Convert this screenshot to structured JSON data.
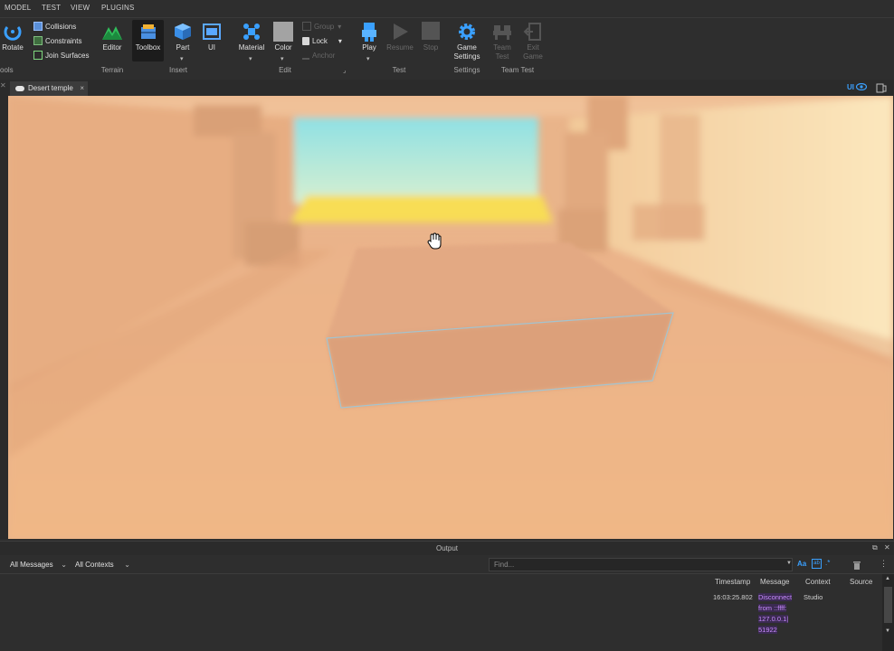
{
  "menu_tabs": [
    "MODEL",
    "TEST",
    "VIEW",
    "PLUGINS"
  ],
  "ribbon": {
    "rotate_label": "Rotate",
    "tools_group_label": "ools",
    "collisions_label": "Collisions",
    "constraints_label": "Constraints",
    "join_surfaces_label": "Join Surfaces",
    "editor_label": "Editor",
    "terrain_group_label": "Terrain",
    "toolbox_label": "Toolbox",
    "part_label": "Part",
    "ui_label": "UI",
    "insert_group_label": "Insert",
    "material_label": "Material",
    "color_label": "Color",
    "group_label": "Group",
    "lock_label": "Lock",
    "anchor_label": "Anchor",
    "edit_group_label": "Edit",
    "play_label": "Play",
    "resume_label": "Resume",
    "stop_label": "Stop",
    "test_group_label": "Test",
    "game_settings_label_1": "Game",
    "game_settings_label_2": "Settings",
    "settings_group_label": "Settings",
    "team_test_label_1": "Team",
    "team_test_label_2": "Test",
    "exit_game_label_1": "Exit",
    "exit_game_label_2": "Game",
    "team_test_group_label": "Team Test"
  },
  "doc_tab": {
    "title": "Desert temple",
    "close": "×"
  },
  "ui_toggle_label": "UI",
  "output": {
    "title": "Output",
    "filter_messages": "All Messages",
    "filter_contexts": "All Contexts",
    "find_placeholder": "Find...",
    "aa_label": "Aa",
    "columns": [
      "Timestamp",
      "Message",
      "Context",
      "Source"
    ],
    "rows": [
      {
        "timestamp": "16:03:25.802",
        "message_lines": [
          "Disconnect",
          "from ::ffff:",
          "127.0.0.1|",
          "51922"
        ],
        "context": "Studio",
        "source": ""
      }
    ]
  },
  "colors": {
    "accent_blue": "#3aa0ff",
    "sand": "#eab58a",
    "sky": "#9fe3e0",
    "message_purple": "#c98bff"
  }
}
